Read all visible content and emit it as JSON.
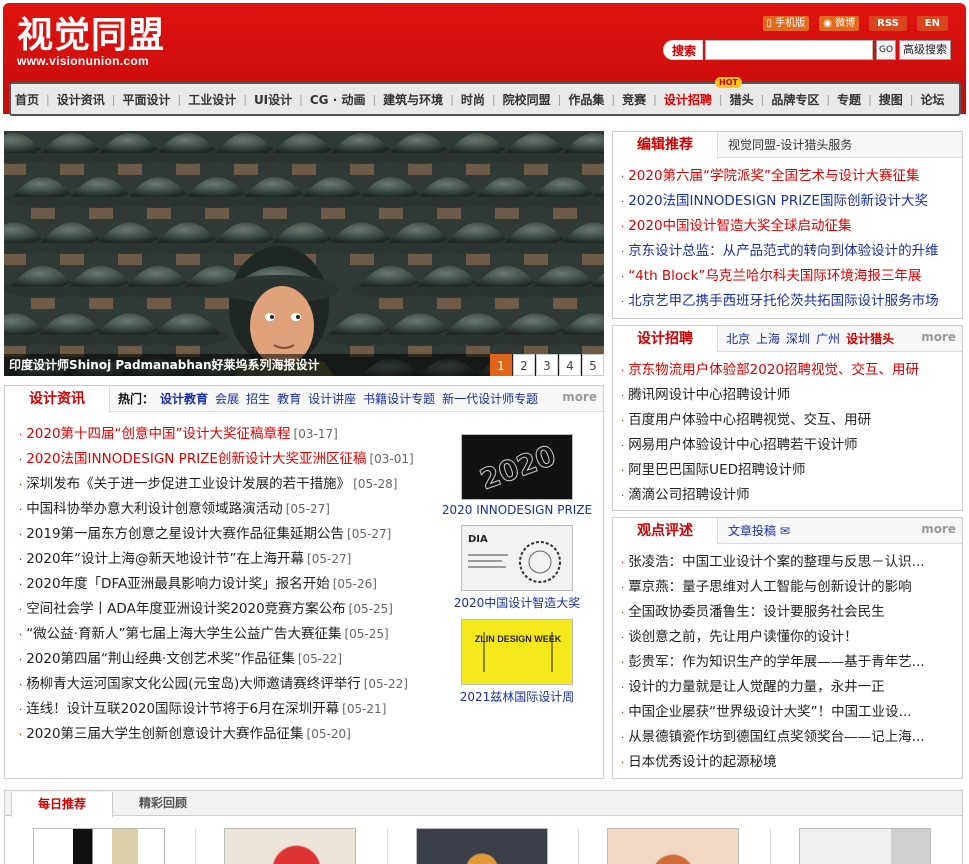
{
  "header": {
    "logo_cn": "视觉同盟",
    "logo_en": "www.visionunion.com",
    "top_links": [
      {
        "label": "手机版",
        "icon": "mobile-icon"
      },
      {
        "label": "微博",
        "icon": "weibo-icon"
      },
      {
        "label": "RSS"
      },
      {
        "label": "EN"
      }
    ],
    "search": {
      "label": "搜索",
      "value": "",
      "go": "GO",
      "advanced": "高级搜索"
    }
  },
  "nav": {
    "items": [
      "首页",
      "设计资讯",
      "平面设计",
      "工业设计",
      "UI设计",
      "CG · 动画",
      "建筑与环境",
      "时尚",
      "院校同盟",
      "作品集",
      "竞赛",
      "设计招聘",
      "猎头",
      "品牌专区",
      "专题",
      "搜图",
      "论坛"
    ],
    "hot_badge": "HOT",
    "hot_item_index": 11
  },
  "slider": {
    "caption": "印度设计师Shinoj Padmanabhan好莱坞系列海报设计",
    "pages": [
      "1",
      "2",
      "3",
      "4",
      "5"
    ],
    "active_page": 0
  },
  "editor": {
    "title": "编辑推荐",
    "sub": "视觉同盟-设计猎头服务",
    "items": [
      {
        "text": "2020第六届“学院派奖”全国艺术与设计大赛征集",
        "color": "red"
      },
      {
        "text": "2020法国INNODESIGN PRIZE国际创新设计大奖",
        "color": "blue"
      },
      {
        "text": "2020中国设计智造大奖全球启动征集",
        "color": "red"
      },
      {
        "text": "京东设计总监：从产品范式的转向到体验设计的升维",
        "color": "blue"
      },
      {
        "text": "“4th Block”乌克兰哈尔科夫国际环境海报三年展",
        "color": "red"
      },
      {
        "text": "北京艺甲乙携手西班牙托伦茨共拓国际设计服务市场",
        "color": "blue"
      }
    ]
  },
  "jobs": {
    "title": "设计招聘",
    "cities": [
      "北京",
      "上海",
      "深圳",
      "广州"
    ],
    "hunter": "设计猎头",
    "more": "more",
    "items": [
      {
        "text": "京东物流用户体验部2020招聘视觉、交互、用研",
        "color": "red"
      },
      {
        "text": "腾讯网设计中心招聘设计师",
        "color": "black"
      },
      {
        "text": "百度用户体验中心招聘视觉、交互、用研",
        "color": "black"
      },
      {
        "text": "网易用户体验设计中心招聘若干设计师",
        "color": "black"
      },
      {
        "text": "阿里巴巴国际UED招聘设计师",
        "color": "black"
      },
      {
        "text": "滴滴公司招聘设计师",
        "color": "black"
      }
    ]
  },
  "opinion": {
    "title": "观点评述",
    "sub": "文章投稿",
    "more": "more",
    "items": [
      "张凌浩：中国工业设计个案的整理与反思－认识...",
      "覃京燕：量子思维对人工智能与创新设计的影响",
      "全国政协委员潘鲁生：设计要服务社会民生",
      "谈创意之前，先让用户读懂你的设计！",
      "彭贵军：作为知识生产的学年展——基于青年艺...",
      "设计的力量就是让人觉醒的力量，永井一正",
      "中国企业屡获“世界级设计大奖”！中国工业设...",
      "从景德镇瓷作坊到德国红点奖领奖台——记上海...",
      "日本优秀设计的起源秘境"
    ]
  },
  "news": {
    "title": "设计资讯",
    "hot_label": "热门：",
    "hot_first": "设计教育",
    "hot_tags": [
      "会展",
      "招生",
      "教育",
      "设计讲座",
      "书籍设计专题",
      "新一代设计师专题"
    ],
    "more": "more",
    "items": [
      {
        "text": "2020第十四届“创意中国”设计大奖征稿章程",
        "date": "[03-17]",
        "color": "red"
      },
      {
        "text": "2020法国INNODESIGN PRIZE创新设计大奖亚洲区征稿",
        "date": "[03-01]",
        "color": "red"
      },
      {
        "text": "深圳发布《关于进一步促进工业设计发展的若干措施》",
        "date": "[05-28]",
        "color": "black"
      },
      {
        "text": "中国科协举办意大利设计创意领域路演活动",
        "date": "[05-27]",
        "color": "black"
      },
      {
        "text": "2019第一届东方创意之星设计大赛作品征集延期公告",
        "date": "[05-27]",
        "color": "black"
      },
      {
        "text": "2020年“设计上海@新天地设计节”在上海开幕",
        "date": "[05-27]",
        "color": "black"
      },
      {
        "text": "2020年度「DFA亚洲最具影响力设计奖」报名开始",
        "date": "[05-26]",
        "color": "black"
      },
      {
        "text": "空间社会学丨ADA年度亚洲设计奖2020竞赛方案公布",
        "date": "[05-25]",
        "color": "black"
      },
      {
        "text": "“微公益·育新人”第七届上海大学生公益广告大赛征集",
        "date": "[05-25]",
        "color": "black"
      },
      {
        "text": "2020第四届“荆山经典·文创艺术奖”作品征集",
        "date": "[05-22]",
        "color": "black"
      },
      {
        "text": "杨柳青大运河国家文化公园(元宝岛)大师邀请赛终评举行",
        "date": "[05-22]",
        "color": "black"
      },
      {
        "text": "连线！设计互联2020国际设计节将于6月在深圳开幕",
        "date": "[05-21]",
        "color": "black"
      },
      {
        "text": "2020第三届大学生创新创意设计大赛作品征集",
        "date": "[05-20]",
        "color": "black"
      }
    ],
    "thumbs": [
      {
        "caption": "2020 INNODESIGN PRIZE",
        "art": "2020"
      },
      {
        "caption": "2020中国设计智造大奖",
        "art": "DIA"
      },
      {
        "caption": "2021兹林国际设计周",
        "art": "ZLIN DESIGN WEEK"
      }
    ]
  },
  "bottom": {
    "tabs": [
      "每日推荐",
      "精彩回顾"
    ]
  }
}
